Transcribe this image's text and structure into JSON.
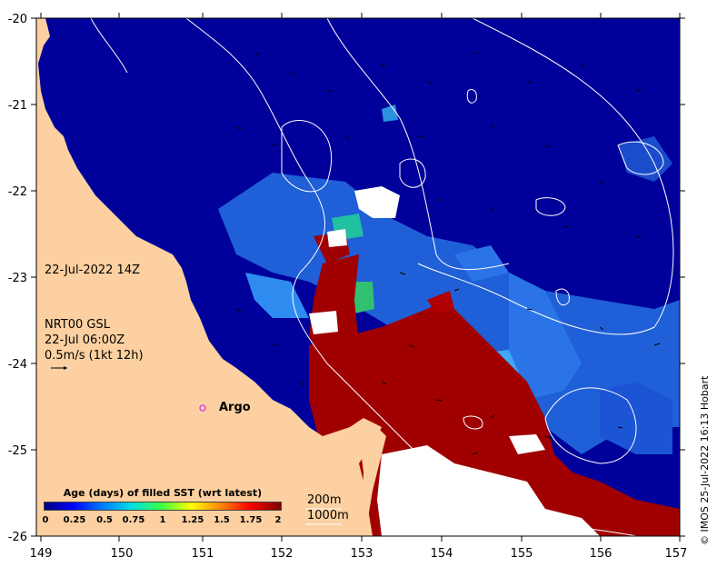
{
  "map": {
    "lon_ticks": [
      "149",
      "150",
      "151",
      "152",
      "153",
      "154",
      "155",
      "156",
      "157"
    ],
    "lat_ticks": [
      "-20",
      "-21",
      "-22",
      "-23",
      "-24",
      "-25",
      "-26"
    ],
    "date_label": "22-Jul-2022 14Z",
    "current_source": "NRT00 GSL",
    "current_time": "22-Jul 06:00Z",
    "current_scale": "0.5m/s (1kt 12h)",
    "argo_label": "Argo",
    "isobath_200": "200m",
    "isobath_1000": "1000m",
    "credit": "© IMOS 25-Jul-2022 16:13 Hobart",
    "colors": {
      "land": "#fcd0a0",
      "ocean": "#00009a",
      "warm": "#a00000",
      "argo": "#e040e0"
    }
  },
  "legend": {
    "title": "Age (days) of filled SST (wrt latest)",
    "ticks": [
      "0",
      "0.25",
      "0.5",
      "0.75",
      "1",
      "1.25",
      "1.5",
      "1.75",
      "2"
    ]
  }
}
